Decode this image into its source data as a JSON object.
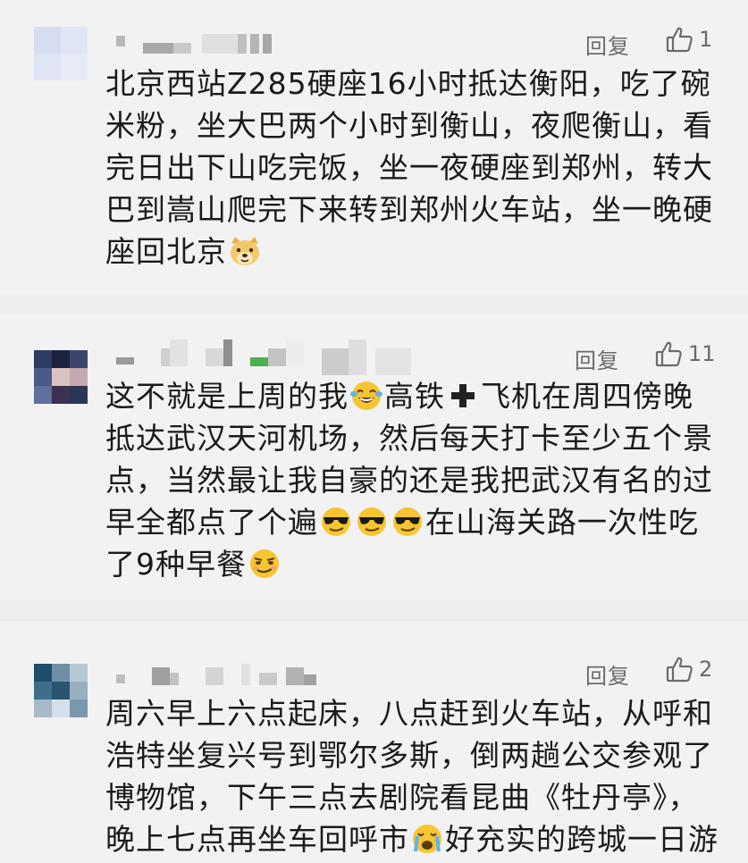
{
  "comments": [
    {
      "reply_label": "回复",
      "likes": "1",
      "segments": {
        "t1": "北京西站Z285硬座16小时抵达衡阳，吃了碗米粉，坐大巴两个小时到衡山，夜爬衡山，看完日出下山吃完饭，坐一夜硬座到郑州，转大巴到嵩山爬完下来转到郑州火车站，坐一晚硬座回北京"
      },
      "emoji": [
        "doge-emoji"
      ]
    },
    {
      "reply_label": "回复",
      "likes": "11",
      "segments": {
        "t1": "这不就是上周的我",
        "t2": "高铁",
        "t3": "飞机在周四傍晚抵达武汉天河机场，然后每天打卡至少五个景点，当然最让我自豪的还是我把武汉有名的过早全都点了个遍",
        "t4": "在山海关路一次性吃了9种早餐"
      },
      "emoji": [
        "laugh-cry-emoji",
        "plus-icon",
        "sunglasses-emoji",
        "sunglasses-emoji",
        "sunglasses-emoji",
        "smirk-emoji"
      ]
    },
    {
      "reply_label": "回复",
      "likes": "2",
      "segments": {
        "t1": "周六早上六点起床，八点赶到火车站，从呼和浩特坐复兴号到鄂尔多斯，倒两趟公交参观了博物馆，下午三点去剧院看昆曲《牡丹亭》，晚上七点再坐车回呼市",
        "t2": "好充实的跨城一日游"
      },
      "emoji": [
        "crying-emoji"
      ]
    }
  ],
  "colors": {
    "background": "#ededed",
    "card": "#f2f2f2",
    "text": "#1a1a1a",
    "meta": "#6b6b6b",
    "emoji_face": "#f7c531"
  }
}
